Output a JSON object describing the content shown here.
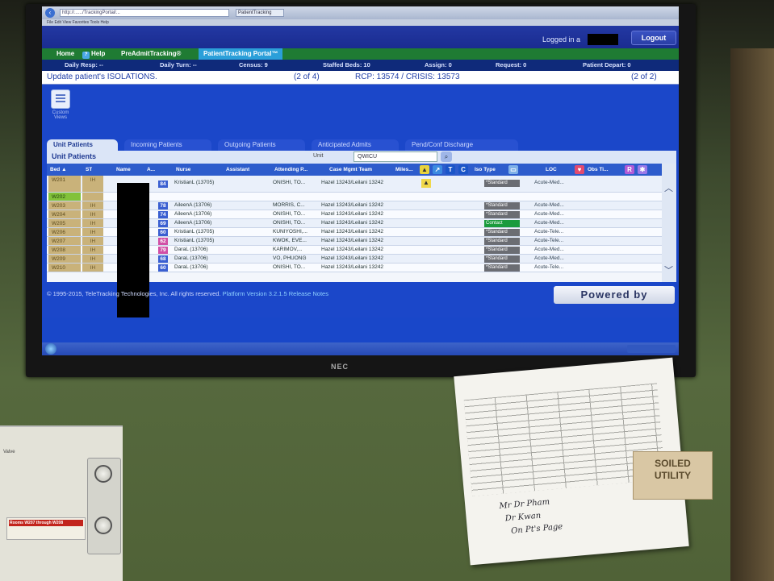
{
  "browser": {
    "address": "http://....../TrackingPortal/...",
    "tab_label": "PatientTracking"
  },
  "header": {
    "logged_in_label": "Logged in a",
    "logout_label": "Logout"
  },
  "nav": {
    "home": "Home",
    "help": "Help",
    "preadmit": "PreAdmitTracking®",
    "portal": "PatientTracking Portal™"
  },
  "stats": {
    "daily_resp": "Daily Resp: --",
    "daily_turn": "Daily Turn: --",
    "census": "Census: 9",
    "staffed_beds": "Staffed Beds: 10",
    "assign": "Assign: 0",
    "request": "Request: 0",
    "patient_depart": "Patient Depart: 0"
  },
  "banner": {
    "message": "Update patient's ISOLATIONS.",
    "page_a": "(2 of 4)",
    "rcp": "RCP: 13574 / CRISIS: 13573",
    "page_b": "(2 of 2)"
  },
  "custom_views": "Custom Views",
  "tabs": [
    "Unit Patients",
    "Incoming Patients",
    "Outgoing Patients",
    "Anticipated Admits",
    "Pend/Conf Discharge"
  ],
  "unit_panel": {
    "title": "Unit Patients",
    "unit_label": "Unit",
    "unit_value": "QWICU"
  },
  "columns": {
    "bed": "Bed ▲",
    "st": "ST",
    "name": "Name",
    "a": "A...",
    "nurse": "Nurse",
    "assistant": "Assistant",
    "attending": "Attending P...",
    "case_mgmt": "Case Mgmt Team",
    "miles": "Miles...",
    "t": "T",
    "c": "C",
    "iso_type": "Iso Type",
    "loc": "LOC",
    "obs": "Obs Ti...",
    "r": "R"
  },
  "rows": [
    {
      "bed": "W201",
      "st": "IH",
      "acuity": "84",
      "acuity_color": "#3a5fd1",
      "nurse": "KristianL (13705)",
      "attending": "ONISHI, TO...",
      "case_mgmt": "Hazel 13243/Leilani 13242",
      "iso": "*Standard",
      "loc": "Acute-Med..."
    },
    {
      "bed": "W202",
      "st": "",
      "acuity": "",
      "acuity_color": "",
      "nurse": "",
      "attending": "",
      "case_mgmt": "",
      "iso": "",
      "loc": ""
    },
    {
      "bed": "W203",
      "st": "IH",
      "acuity": "78",
      "acuity_color": "#3a5fd1",
      "nurse": "AileenA (13706)",
      "attending": "MORRIS, C...",
      "case_mgmt": "Hazel 13243/Leilani 13242",
      "iso": "*Standard",
      "loc": "Acute-Med..."
    },
    {
      "bed": "W204",
      "st": "IH",
      "acuity": "74",
      "acuity_color": "#3a5fd1",
      "nurse": "AileenA (13706)",
      "attending": "ONISHI, TO...",
      "case_mgmt": "Hazel 13243/Leilani 13242",
      "iso": "*Standard",
      "loc": "Acute-Med..."
    },
    {
      "bed": "W205",
      "st": "IH",
      "acuity": "69",
      "acuity_color": "#3a5fd1",
      "nurse": "AileenA (13706)",
      "attending": "ONISHI, TO...",
      "case_mgmt": "Hazel 13243/Leilani 13242",
      "iso": "Contact",
      "loc": "Acute-Med..."
    },
    {
      "bed": "W206",
      "st": "IH",
      "acuity": "60",
      "acuity_color": "#3a5fd1",
      "nurse": "KristianL (13705)",
      "attending": "KUNIYOSHI,...",
      "case_mgmt": "Hazel 13243/Leilani 13242",
      "iso": "*Standard",
      "loc": "Acute-Tele..."
    },
    {
      "bed": "W207",
      "st": "IH",
      "acuity": "62",
      "acuity_color": "#d14fa6",
      "nurse": "KristianL (13705)",
      "attending": "KWOK, EVE...",
      "case_mgmt": "Hazel 13243/Leilani 13242",
      "iso": "*Standard",
      "loc": "Acute-Tele..."
    },
    {
      "bed": "W208",
      "st": "IH",
      "acuity": "79",
      "acuity_color": "#d14fa6",
      "nurse": "DaraL (13706)",
      "attending": "KARIMOV,...",
      "case_mgmt": "Hazel 13243/Leilani 13242",
      "iso": "*Standard",
      "loc": "Acute-Med..."
    },
    {
      "bed": "W209",
      "st": "IH",
      "acuity": "68",
      "acuity_color": "#3a5fd1",
      "nurse": "DaraL (13706)",
      "attending": "VO, PHUONG",
      "case_mgmt": "Hazel 13243/Leilani 13242",
      "iso": "*Standard",
      "loc": "Acute-Med..."
    },
    {
      "bed": "W210",
      "st": "IH",
      "acuity": "60",
      "acuity_color": "#3a5fd1",
      "nurse": "DaraL (13706)",
      "attending": "ONISHI, TO...",
      "case_mgmt": "Hazel 13243/Leilani 13242",
      "iso": "*Standard",
      "loc": "Acute-Tele..."
    }
  ],
  "footer": {
    "copyright": "© 1995-2015, TeleTracking Technologies, Inc. All rights reserved.",
    "platform": "Platform Version 3.2.1.5",
    "release_notes": "Release Notes",
    "powered_by": "Powered by"
  },
  "monitor_brand": "NEC",
  "sign": {
    "line1": "SOILED",
    "line2": "UTILITY"
  },
  "note": {
    "hand1": "Mr Dr Pham",
    "hand2": "Dr Kwan",
    "hand3": "On Pt's Page"
  },
  "panel": {
    "label": "Valve",
    "heading": "Rooms W207 through W208"
  }
}
